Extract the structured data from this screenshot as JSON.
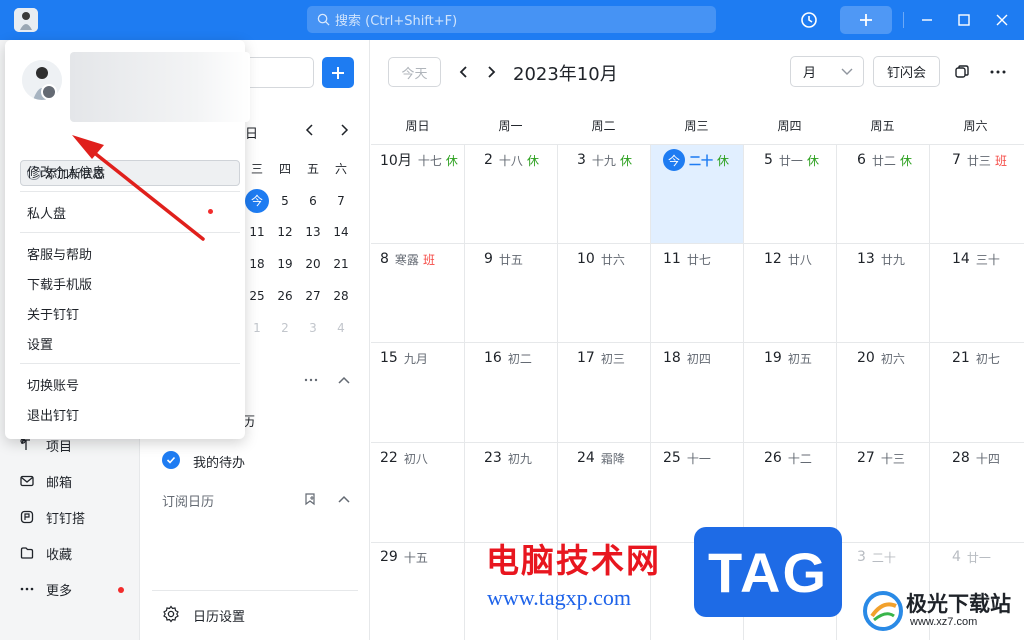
{
  "titlebar": {
    "search_placeholder": "搜索 (Ctrl+Shift+F)",
    "accent": "#1e7cf2"
  },
  "leftnav": {
    "items": [
      {
        "label": "项目",
        "icon": "project-icon"
      },
      {
        "label": "邮箱",
        "icon": "mail-icon"
      },
      {
        "label": "钉钉搭",
        "icon": "build-icon"
      },
      {
        "label": "收藏",
        "icon": "favorite-icon"
      },
      {
        "label": "更多",
        "icon": "more-icon"
      }
    ]
  },
  "sidebar": {
    "mini_calendar": {
      "weekday_headers": [
        "三",
        "四",
        "五",
        "六"
      ],
      "header_fragment": "日",
      "rows": [
        [
          "今",
          "5",
          "6",
          "7"
        ],
        [
          "11",
          "12",
          "13",
          "14"
        ],
        [
          "18",
          "19",
          "20",
          "21"
        ],
        [
          "25",
          "26",
          "27",
          "28"
        ],
        [
          "1",
          "2",
          "3",
          "4"
        ]
      ]
    },
    "my_calendar_fragment": "历",
    "todo_label": "我的待办",
    "subscribed_label": "订阅日历",
    "settings_label": "日历设置"
  },
  "toolbar": {
    "today_label": "今天",
    "month_title": "2023年10月",
    "view_label": "月",
    "meet_label": "钉闪会"
  },
  "calendar": {
    "weekdays": [
      "周日",
      "周一",
      "周二",
      "周三",
      "周四",
      "周五",
      "周六"
    ],
    "weeks": [
      [
        {
          "num": "10月",
          "lunar": "十七",
          "tag": "休",
          "tag_type": "rest"
        },
        {
          "num": "2",
          "lunar": "十八",
          "tag": "休",
          "tag_type": "rest"
        },
        {
          "num": "3",
          "lunar": "十九",
          "tag": "休",
          "tag_type": "rest"
        },
        {
          "num": "今",
          "lunar": "二十",
          "tag": "休",
          "tag_type": "rest",
          "today": true
        },
        {
          "num": "5",
          "lunar": "廿一",
          "tag": "休",
          "tag_type": "rest"
        },
        {
          "num": "6",
          "lunar": "廿二",
          "tag": "休",
          "tag_type": "rest"
        },
        {
          "num": "7",
          "lunar": "廿三",
          "tag": "班",
          "tag_type": "work"
        }
      ],
      [
        {
          "num": "8",
          "lunar": "寒露",
          "tag": "班",
          "tag_type": "work"
        },
        {
          "num": "9",
          "lunar": "廿五"
        },
        {
          "num": "10",
          "lunar": "廿六"
        },
        {
          "num": "11",
          "lunar": "廿七"
        },
        {
          "num": "12",
          "lunar": "廿八"
        },
        {
          "num": "13",
          "lunar": "廿九"
        },
        {
          "num": "14",
          "lunar": "三十"
        }
      ],
      [
        {
          "num": "15",
          "lunar": "九月"
        },
        {
          "num": "16",
          "lunar": "初二"
        },
        {
          "num": "17",
          "lunar": "初三"
        },
        {
          "num": "18",
          "lunar": "初四"
        },
        {
          "num": "19",
          "lunar": "初五"
        },
        {
          "num": "20",
          "lunar": "初六"
        },
        {
          "num": "21",
          "lunar": "初七"
        }
      ],
      [
        {
          "num": "22",
          "lunar": "初八"
        },
        {
          "num": "23",
          "lunar": "初九"
        },
        {
          "num": "24",
          "lunar": "霜降"
        },
        {
          "num": "25",
          "lunar": "十一"
        },
        {
          "num": "26",
          "lunar": "十二"
        },
        {
          "num": "27",
          "lunar": "十三"
        },
        {
          "num": "28",
          "lunar": "十四"
        }
      ],
      [
        {
          "num": "29",
          "lunar": "十五"
        },
        {
          "num": "",
          "lunar": ""
        },
        {
          "num": "",
          "lunar": ""
        },
        {
          "num": "",
          "lunar": ""
        },
        {
          "num": "",
          "lunar": ""
        },
        {
          "num": "3",
          "lunar": "二十",
          "muted": true
        },
        {
          "num": "4",
          "lunar": "廿一",
          "muted": true
        }
      ]
    ]
  },
  "profile_menu": {
    "status_button": "添加新状态",
    "items": [
      {
        "label": "修改个人信息"
      },
      {
        "label": "私人盘",
        "dot": true
      },
      {
        "label": "客服与帮助"
      },
      {
        "label": "下载手机版"
      },
      {
        "label": "关于钉钉"
      },
      {
        "label": "设置"
      },
      {
        "label": "切换账号"
      },
      {
        "label": "退出钉钉"
      }
    ]
  },
  "watermark": {
    "cn_text": "电脑技术网",
    "url": "www.tagxp.com",
    "tag": "TAG",
    "site_name": "极光下载站",
    "site_url": "www.xz7.com"
  }
}
